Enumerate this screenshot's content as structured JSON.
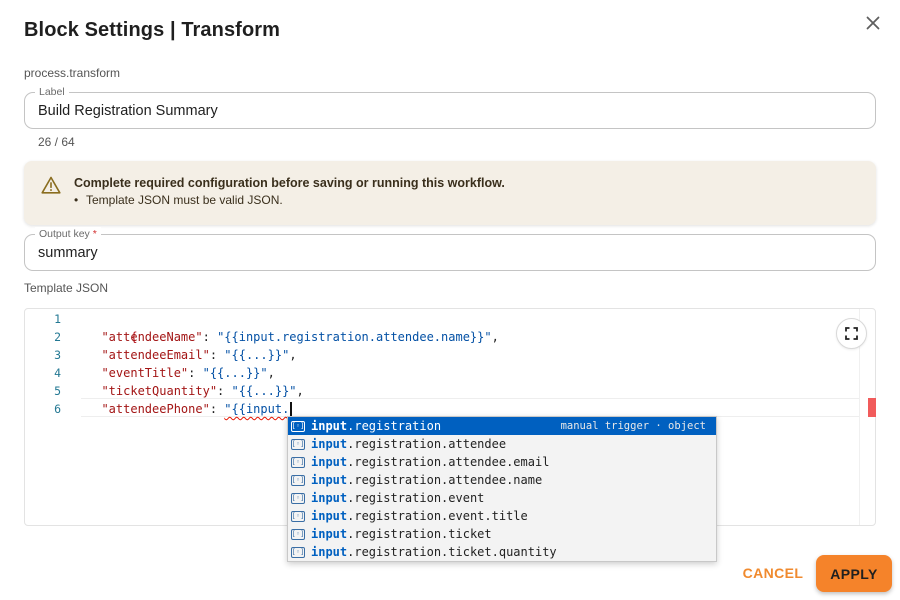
{
  "dialog": {
    "title": "Block Settings | Transform",
    "close_icon": "close-icon",
    "block_type": "process.transform"
  },
  "label_field": {
    "legend": "Label",
    "value": "Build Registration Summary",
    "char_count": "26 / 64"
  },
  "alert": {
    "icon": "warning-icon",
    "title": "Complete required configuration before saving or running this workflow.",
    "items": [
      "Template JSON must be valid JSON."
    ]
  },
  "output_key": {
    "legend": "Output key",
    "required_mark": "*",
    "value": "summary"
  },
  "template": {
    "label": "Template JSON",
    "expand_icon": "fullscreen-icon",
    "line_numbers": [
      "1",
      "2",
      "3",
      "4",
      "5",
      "6"
    ],
    "lines": [
      {
        "open": "{"
      },
      {
        "key": "\"attendeeName\"",
        "sep": ": ",
        "val": "\"{{input.registration.attendee.name}}\"",
        "end": ","
      },
      {
        "key": "\"attendeeEmail\"",
        "sep": ": ",
        "val": "\"{{...}}\"",
        "end": ","
      },
      {
        "key": "\"eventTitle\"",
        "sep": ": ",
        "val": "\"{{...}}\"",
        "end": ","
      },
      {
        "key": "\"ticketQuantity\"",
        "sep": ": ",
        "val": "\"{{...}}\"",
        "end": ","
      },
      {
        "key": "\"attendeePhone\"",
        "sep": ": ",
        "val": "\"{{input.",
        "end": ""
      }
    ]
  },
  "autocomplete": {
    "match_prefix": "input",
    "items": [
      {
        "rest": ".registration",
        "detail": "manual trigger · object"
      },
      {
        "rest": ".registration.attendee",
        "detail": ""
      },
      {
        "rest": ".registration.attendee.email",
        "detail": ""
      },
      {
        "rest": ".registration.attendee.name",
        "detail": ""
      },
      {
        "rest": ".registration.event",
        "detail": ""
      },
      {
        "rest": ".registration.event.title",
        "detail": ""
      },
      {
        "rest": ".registration.ticket",
        "detail": ""
      },
      {
        "rest": ".registration.ticket.quantity",
        "detail": ""
      }
    ],
    "selected_index": 0,
    "symbol_icon": "variable-symbol-icon"
  },
  "actions": {
    "cancel": "CANCEL",
    "apply": "APPLY"
  },
  "colors": {
    "accent": "#f5832a",
    "warning_bg": "#f4efe6",
    "suggest_selected": "#0060c0"
  }
}
